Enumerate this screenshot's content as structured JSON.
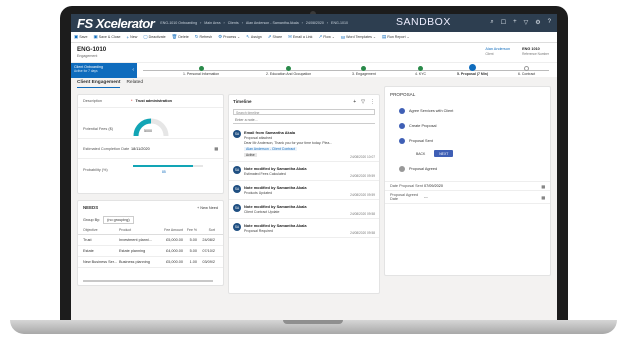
{
  "app": {
    "logo": "FS Xcelerator",
    "breadcrumb": [
      "ENG-1010 Onboarding",
      "Main Area",
      "Clients",
      "Alan Anderson - Samantha Akala",
      "24/08/2020",
      "ENG-1010"
    ],
    "sandbox": "SANDBOX"
  },
  "commands": [
    {
      "icon": "save-icon",
      "label": "Save"
    },
    {
      "icon": "save-close-icon",
      "label": "Save & Close"
    },
    {
      "icon": "plus-icon",
      "label": "New"
    },
    {
      "icon": "deactivate-icon",
      "label": "Deactivate"
    },
    {
      "icon": "delete-icon",
      "label": "Delete"
    },
    {
      "icon": "refresh-icon",
      "label": "Refresh"
    },
    {
      "icon": "process-icon",
      "label": "Process"
    },
    {
      "icon": "assign-icon",
      "label": "Assign"
    },
    {
      "icon": "share-icon",
      "label": "Share"
    },
    {
      "icon": "email-icon",
      "label": "Email a Link"
    },
    {
      "icon": "flow-icon",
      "label": "Flow"
    },
    {
      "icon": "word-icon",
      "label": "Word Templates"
    },
    {
      "icon": "report-icon",
      "label": "Run Report"
    }
  ],
  "record": {
    "title": "ENG-1010",
    "subtitle": "Engagement",
    "header_fields": [
      {
        "value": "Alan Anderson",
        "label": "Client"
      },
      {
        "value": "ENG 1010",
        "label": "Reference Number"
      }
    ]
  },
  "bpf": {
    "active_label": "Client Onboarding",
    "active_sub": "Active for 7 days",
    "stages": [
      {
        "label": "1. Personal Information",
        "state": "done"
      },
      {
        "label": "2. Education And Occupation",
        "state": "done"
      },
      {
        "label": "3. Engagement",
        "state": "done"
      },
      {
        "label": "4. KYC",
        "state": "done"
      },
      {
        "label": "5. Proposal (7 Min)",
        "state": "current"
      },
      {
        "label": "6. Contract",
        "state": "todo"
      }
    ]
  },
  "tabs": [
    "Client Engagement",
    "Related"
  ],
  "engagement": {
    "description_label": "Description",
    "description_value": "Trust administration",
    "potential_fees_label": "Potential Fees ($)",
    "gauge_value": "5000",
    "gauge_fraction": 0.5,
    "completion_label": "Estimated Completion Date",
    "completion_value": "18/11/2020",
    "probability_label": "Probability (%)",
    "probability_value": "85",
    "probability_fraction": 0.85
  },
  "needs": {
    "title": "NEEDS",
    "new_label": "+ New Need",
    "group_by_label": "Group By:",
    "group_by_value": "(no grouping)",
    "columns": [
      "Objective",
      "Product",
      "Fee Amount",
      "Fee %",
      "Sort"
    ],
    "rows": [
      [
        "Trust",
        "Investment planni...",
        "£5,000.00",
        "5.00",
        "24/08/2"
      ],
      [
        "Estate",
        "Estate planning",
        "£4,000.00",
        "5.00",
        "07/10/2"
      ],
      [
        "New Business Ser...",
        "Business planning",
        "£5,000.00",
        "1.00",
        "03/09/2"
      ]
    ]
  },
  "timeline": {
    "title": "Timeline",
    "search_placeholder": "Search timeline",
    "note_placeholder": "Enter a note...",
    "items": [
      {
        "initials": "SA",
        "title": "Email from Samantha Akala",
        "body": "Proposal attached",
        "body2": "Dear Mr Anderson, Thank you for your time today. Plea...",
        "link": "Alan Anderson - Client Contract",
        "tag": "Active",
        "date": "24/08/2020 10:07"
      },
      {
        "initials": "SA",
        "title": "Note modified by Samantha Akala",
        "body": "Estimated Fees Calculated",
        "body2": "",
        "link": "",
        "tag": "",
        "date": "24/08/2020 09:59"
      },
      {
        "initials": "SA",
        "title": "Note modified by Samantha Akala",
        "body": "Products Updated",
        "body2": "",
        "link": "",
        "tag": "",
        "date": "24/08/2020 09:59"
      },
      {
        "initials": "SA",
        "title": "Note modified by Samantha Akala",
        "body": "Client Contract Update",
        "body2": "",
        "link": "",
        "tag": "",
        "date": "24/08/2020 09:58"
      },
      {
        "initials": "SA",
        "title": "Note modified by Samantha Akala",
        "body": "Proposal Required",
        "body2": "",
        "link": "",
        "tag": "",
        "date": "24/08/2020 09:58"
      }
    ]
  },
  "proposal": {
    "title": "PROPOSAL",
    "steps": [
      {
        "label": "Agree Services with Client",
        "state": "done"
      },
      {
        "label": "Create Proposal",
        "state": "done"
      },
      {
        "label": "Proposal Sent",
        "state": "done"
      },
      {
        "label": "Proposal Agreed",
        "state": "todo"
      }
    ],
    "back_label": "BACK",
    "next_label": "NEXT",
    "sent_label": "Date Proposal Sent",
    "sent_value": "07/09/2020",
    "agreed_label": "Proposal Agreed Date",
    "agreed_value": "---"
  }
}
